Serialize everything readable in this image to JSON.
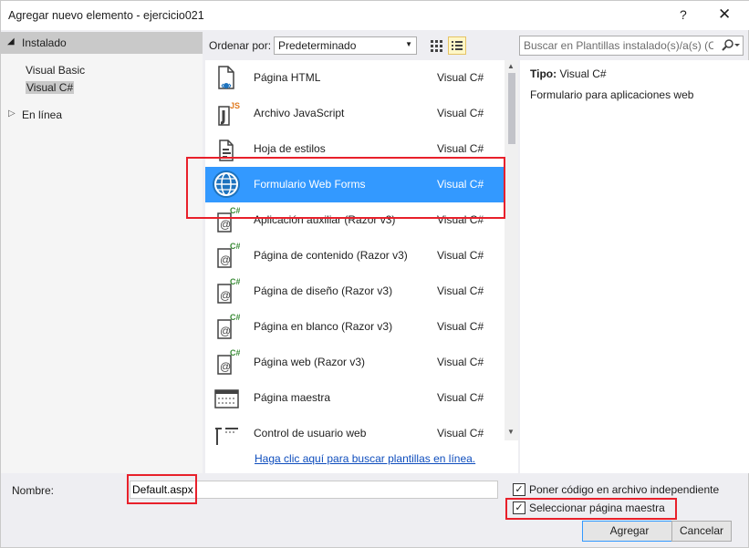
{
  "window": {
    "title": "Agregar nuevo elemento - ejercicio021",
    "help_label": "?",
    "close_label": "✕"
  },
  "tree": {
    "installed_arrow": "◢",
    "installed": "Instalado",
    "children": [
      "Visual Basic",
      "Visual C#"
    ],
    "online_arrow": "▷",
    "online": "En línea"
  },
  "toolbar": {
    "sort_label": "Ordenar por:",
    "sort_value": "Predeterminado",
    "search_placeholder": "Buscar en Plantillas instalado(s)/a(s) (Ctrl+E)"
  },
  "templates": [
    {
      "name": "Página HTML",
      "lang": "Visual C#",
      "icon": "html-page-icon"
    },
    {
      "name": "Archivo JavaScript",
      "lang": "Visual C#",
      "icon": "javascript-file-icon"
    },
    {
      "name": "Hoja de estilos",
      "lang": "Visual C#",
      "icon": "stylesheet-icon"
    },
    {
      "name": "Formulario Web Forms",
      "lang": "Visual C#",
      "icon": "globe-icon",
      "selected": true
    },
    {
      "name": "Aplicación auxiliar (Razor v3)",
      "lang": "Visual C#",
      "icon": "razor-page-icon"
    },
    {
      "name": "Página de contenido (Razor v3)",
      "lang": "Visual C#",
      "icon": "razor-page-icon"
    },
    {
      "name": "Página de diseño (Razor v3)",
      "lang": "Visual C#",
      "icon": "razor-page-icon"
    },
    {
      "name": "Página en blanco (Razor v3)",
      "lang": "Visual C#",
      "icon": "razor-page-icon"
    },
    {
      "name": "Página web (Razor v3)",
      "lang": "Visual C#",
      "icon": "razor-page-icon"
    },
    {
      "name": "Página maestra",
      "lang": "Visual C#",
      "icon": "master-page-icon"
    },
    {
      "name": "Control de usuario web",
      "lang": "Visual C#",
      "icon": "user-control-icon"
    }
  ],
  "online_link": "Haga clic aquí para buscar plantillas en línea.",
  "details": {
    "type_label": "Tipo:",
    "type_value": "Visual C#",
    "description": "Formulario para aplicaciones web"
  },
  "form": {
    "name_label": "Nombre:",
    "name_value": "Default.aspx",
    "checkbox_separate_code": "Poner código en archivo independiente",
    "checkbox_master_page": "Seleccionar página maestra",
    "check_mark": "✓"
  },
  "buttons": {
    "add": "Agregar",
    "cancel": "Cancelar"
  },
  "colors": {
    "selection": "#3399ff",
    "highlight_box": "#e8202b",
    "link": "#0e4dbd"
  }
}
